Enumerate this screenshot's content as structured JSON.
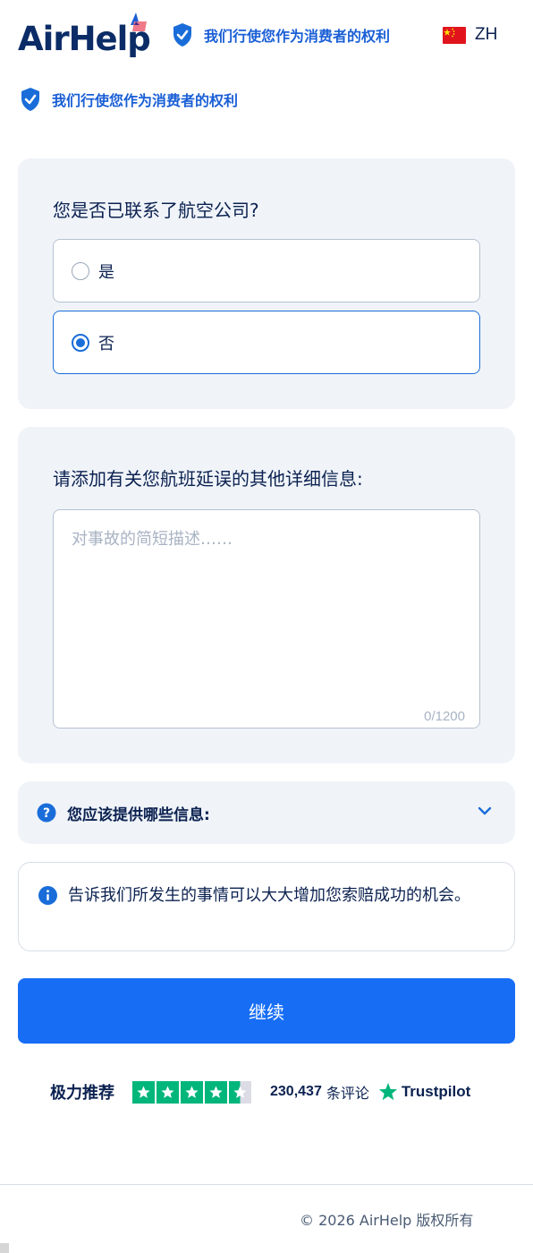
{
  "header": {
    "logo_text": "AirHelp",
    "rights_text": "我们行使您作为消费者的权利",
    "language_code": "ZH"
  },
  "rights_banner": {
    "text": "我们行使您作为消费者的权利"
  },
  "airline_contact": {
    "question": "您是否已联系了航空公司?",
    "options": [
      {
        "label": "是",
        "selected": false
      },
      {
        "label": "否",
        "selected": true
      }
    ]
  },
  "details": {
    "question": "请添加有关您航班延误的其他详细信息:",
    "placeholder": "对事故的简短描述……",
    "value": "",
    "counter": "0/1200"
  },
  "help_accordion": {
    "label": "您应该提供哪些信息:"
  },
  "info_note": {
    "text": "告诉我们所发生的事情可以大大增加您索赔成功的机会。"
  },
  "continue_button": {
    "label": "继续"
  },
  "trustpilot": {
    "recommend": "极力推荐",
    "rating_stars": 4.5,
    "review_count": "230,437",
    "reviews_label": "条评论",
    "brand": "Trustpilot"
  },
  "footer": {
    "copyright": "© 2026 AirHelp 版权所有"
  },
  "colors": {
    "primary": "#176ef5",
    "navy": "#0b2150",
    "card_bg": "#f0f4f9",
    "trustpilot_green": "#00b67a",
    "flag_red": "#e1141d"
  }
}
